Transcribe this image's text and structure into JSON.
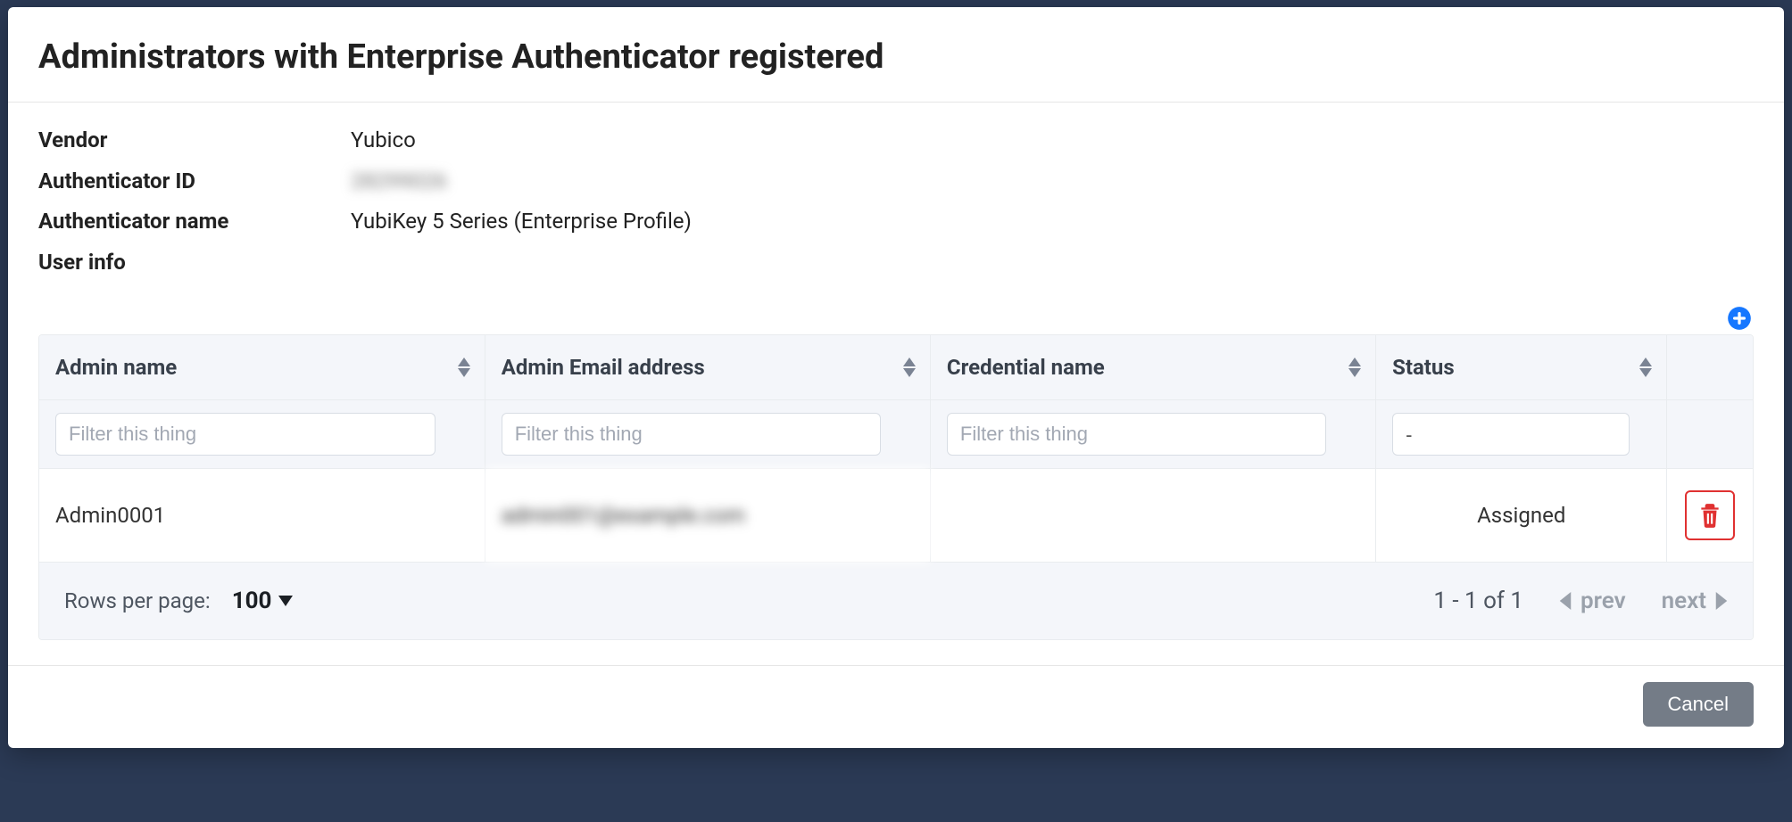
{
  "modal": {
    "title": "Administrators with Enterprise Authenticator registered",
    "vendor_label": "Vendor",
    "vendor_value": "Yubico",
    "auth_id_label": "Authenticator ID",
    "auth_id_value": "28299026",
    "auth_name_label": "Authenticator name",
    "auth_name_value": "YubiKey 5 Series (Enterprise Profile)",
    "user_info_label": "User info",
    "cancel": "Cancel"
  },
  "table": {
    "headers": {
      "name": "Admin name",
      "email": "Admin Email address",
      "cred": "Credential name",
      "status": "Status"
    },
    "filter_placeholder": "Filter this thing",
    "status_default": "-",
    "rows": [
      {
        "name": "Admin0001",
        "email": "admin001@example.com",
        "cred": "",
        "status": "Assigned"
      }
    ],
    "footer": {
      "rpp_label": "Rows per page:",
      "rpp_value": "100",
      "range": "1 - 1 of 1",
      "prev": "prev",
      "next": "next"
    }
  },
  "icons": {
    "add": "plus-circle",
    "delete": "trash"
  }
}
